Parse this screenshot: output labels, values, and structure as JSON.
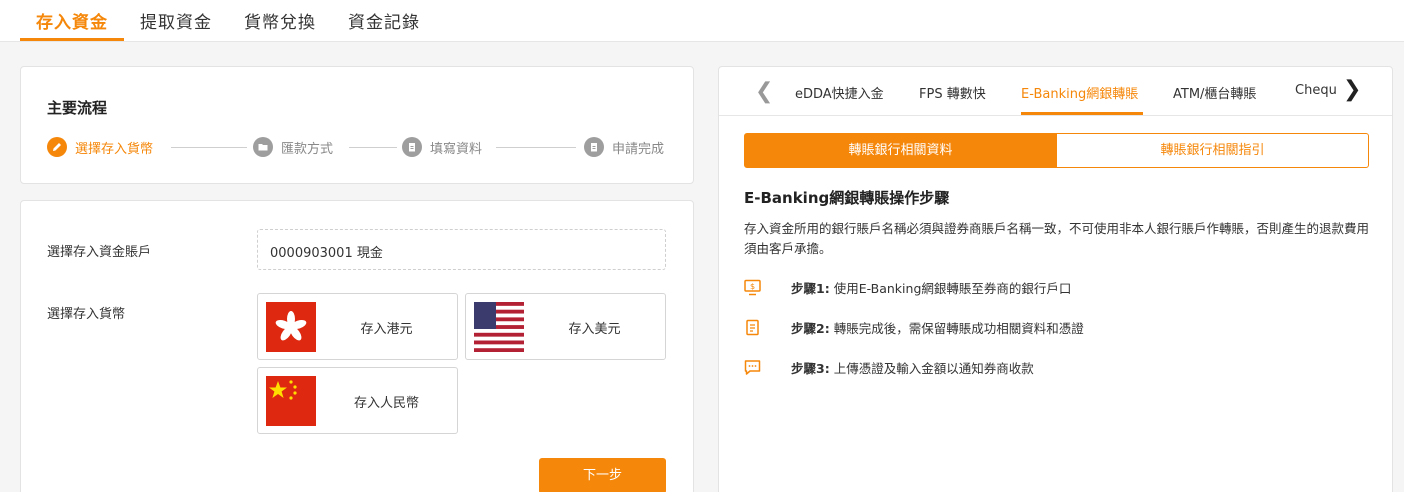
{
  "top_tabs": [
    "存入資金",
    "提取資金",
    "貨幣兌換",
    "資金記錄"
  ],
  "flow": {
    "title": "主要流程",
    "steps": [
      "選擇存入貨幣",
      "匯款方式",
      "填寫資料",
      "申請完成"
    ]
  },
  "form": {
    "account_label": "選擇存入資金賬戶",
    "account_value": "0000903001 現金",
    "currency_label": "選擇存入貨幣",
    "currencies": [
      "存入港元",
      "存入美元",
      "存入人民幣"
    ],
    "next_label": "下一步"
  },
  "methods": {
    "tabs": [
      "eDDA快捷入金",
      "FPS 轉數快",
      "E-Banking網銀轉賬",
      "ATM/櫃台轉賬",
      "Chequ"
    ],
    "sub_tabs": [
      "轉賬銀行相關資料",
      "轉賬銀行相關指引"
    ],
    "guide_title": "E-Banking網銀轉賬操作步驟",
    "guide_desc": "存入資金所用的銀行賬戶名稱必須與證券商賬戶名稱一致，不可使用非本人銀行賬戶作轉賬，否則產生的退款費用須由客戶承擔。",
    "steps": [
      {
        "num": "步驟1:",
        "text": "使用E-Banking網銀轉賬至券商的銀行戶口"
      },
      {
        "num": "步驟2:",
        "text": "轉賬完成後，需保留轉賬成功相關資料和憑證"
      },
      {
        "num": "步驟3:",
        "text": "上傳憑證及輸入金額以通知券商收款"
      }
    ]
  },
  "colors": {
    "accent": "#f5870a",
    "inactive_step": "#9e9e9e"
  }
}
